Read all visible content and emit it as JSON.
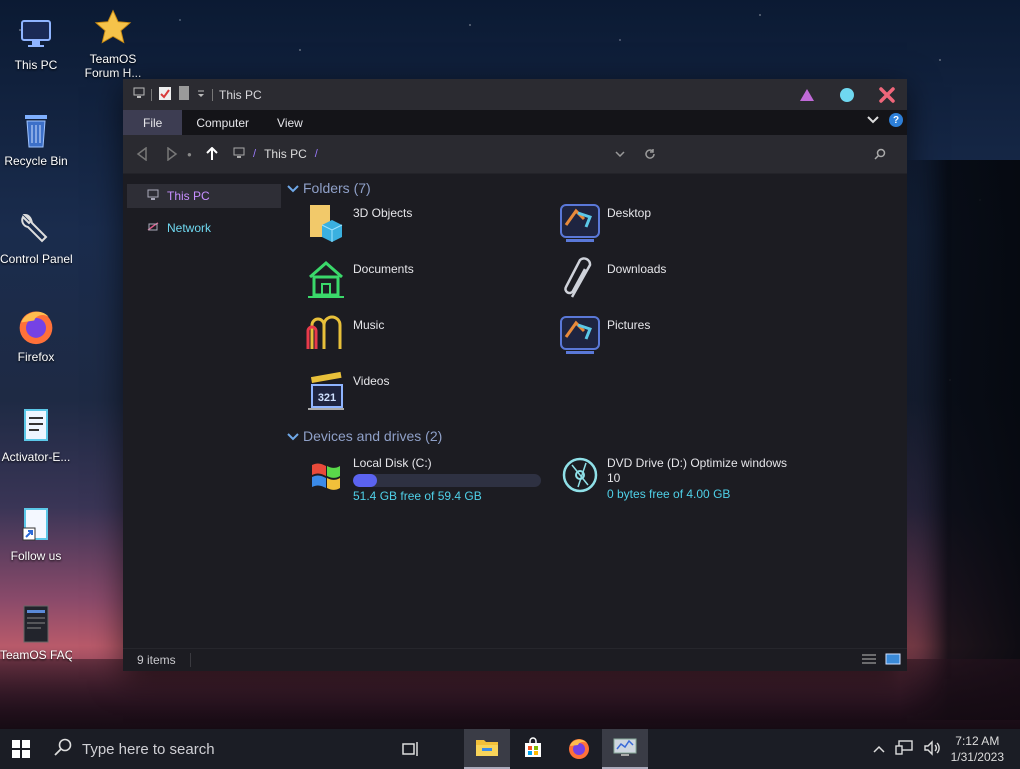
{
  "desktop": {
    "icons": [
      {
        "label": "This PC"
      },
      {
        "label": "TeamOS Forum H..."
      },
      {
        "label": "Recycle Bin"
      },
      {
        "label": "Control Panel"
      },
      {
        "label": "Firefox"
      },
      {
        "label": "Activator-E..."
      },
      {
        "label": "Follow us"
      },
      {
        "label": "TeamOS FAQ"
      }
    ]
  },
  "window": {
    "title": "This PC",
    "ribbon_tabs": [
      {
        "label": "File",
        "active": true
      },
      {
        "label": "Computer"
      },
      {
        "label": "View"
      }
    ],
    "help_label": "?",
    "address": {
      "crumbs": [
        "This PC"
      ]
    },
    "nav": [
      {
        "label": "This PC",
        "selected": true
      },
      {
        "label": "Network"
      }
    ],
    "folders_header": "Folders (7)",
    "folders": [
      {
        "name": "3D Objects",
        "icon": "3d-objects-icon"
      },
      {
        "name": "Desktop",
        "icon": "desktop-folder-icon"
      },
      {
        "name": "Documents",
        "icon": "documents-icon"
      },
      {
        "name": "Downloads",
        "icon": "downloads-icon"
      },
      {
        "name": "Music",
        "icon": "music-icon"
      },
      {
        "name": "Pictures",
        "icon": "pictures-icon"
      },
      {
        "name": "Videos",
        "icon": "videos-icon"
      }
    ],
    "drives_header": "Devices and drives (2)",
    "drives": [
      {
        "name": "Local Disk (C:)",
        "free": "51.4 GB free of 59.4 GB",
        "used_fraction": 0.13
      },
      {
        "name": "DVD Drive (D:) Optimize windows 10",
        "free": "0 bytes free of 4.00 GB"
      }
    ],
    "status": "9 items"
  },
  "taskbar": {
    "search_placeholder": "Type here to search",
    "time": "7:12 AM",
    "date": "1/31/2023"
  },
  "colors": {
    "accent": "#9d7bff",
    "free_text": "#4fd0e8",
    "bar_fill": "#5b63f0"
  }
}
